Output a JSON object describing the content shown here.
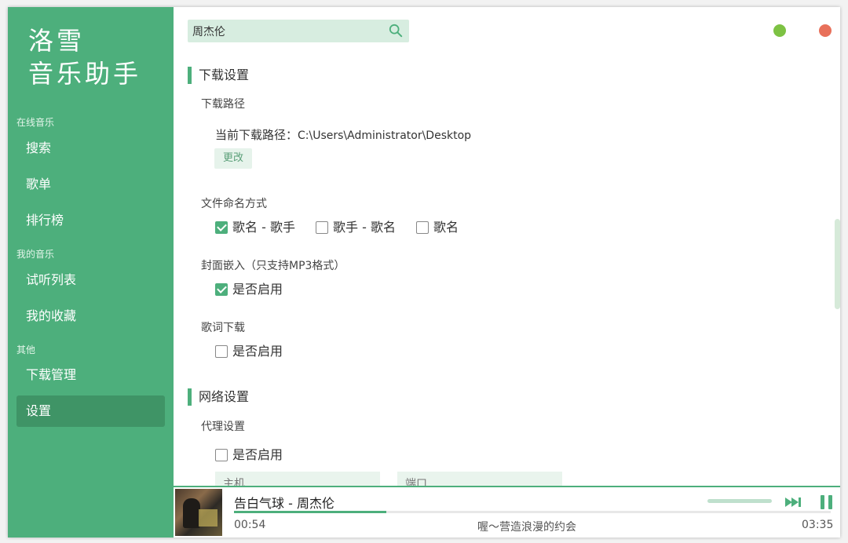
{
  "app": {
    "logo_line1": "洛雪",
    "logo_line2": "音乐助手"
  },
  "sidebar": {
    "groups": [
      {
        "title": "在线音乐",
        "items": [
          "搜索",
          "歌单",
          "排行榜"
        ]
      },
      {
        "title": "我的音乐",
        "items": [
          "试听列表",
          "我的收藏"
        ]
      },
      {
        "title": "其他",
        "items": [
          "下载管理",
          "设置"
        ]
      }
    ],
    "active": "设置"
  },
  "search": {
    "value": "周杰伦",
    "icon": "search-icon"
  },
  "window_controls": {
    "minimize_color": "#7dc243",
    "close_color": "#e8705a"
  },
  "settings": {
    "download_section": {
      "title": "下载设置",
      "path_label": "下载路径",
      "current_path_prefix": "当前下载路径：",
      "current_path": "C:\\Users\\Administrator\\Desktop",
      "change_button": "更改",
      "naming_label": "文件命名方式",
      "naming_options": [
        {
          "label": "歌名 - 歌手",
          "checked": true
        },
        {
          "label": "歌手 - 歌名",
          "checked": false
        },
        {
          "label": "歌名",
          "checked": false
        }
      ],
      "cover_label": "封面嵌入（只支持MP3格式）",
      "cover_option": {
        "label": "是否启用",
        "checked": true
      },
      "lyrics_label": "歌词下载",
      "lyrics_option": {
        "label": "是否启用",
        "checked": false
      }
    },
    "network_section": {
      "title": "网络设置",
      "proxy_label": "代理设置",
      "proxy_option": {
        "label": "是否启用",
        "checked": false
      },
      "host_placeholder": "主机",
      "port_placeholder": "端口"
    }
  },
  "player": {
    "title": "告白气球 - 周杰伦",
    "current_time": "00:54",
    "total_time": "03:35",
    "lyric": "喔～营造浪漫的约会",
    "progress": 0.255,
    "accent": "#4daf7c"
  }
}
